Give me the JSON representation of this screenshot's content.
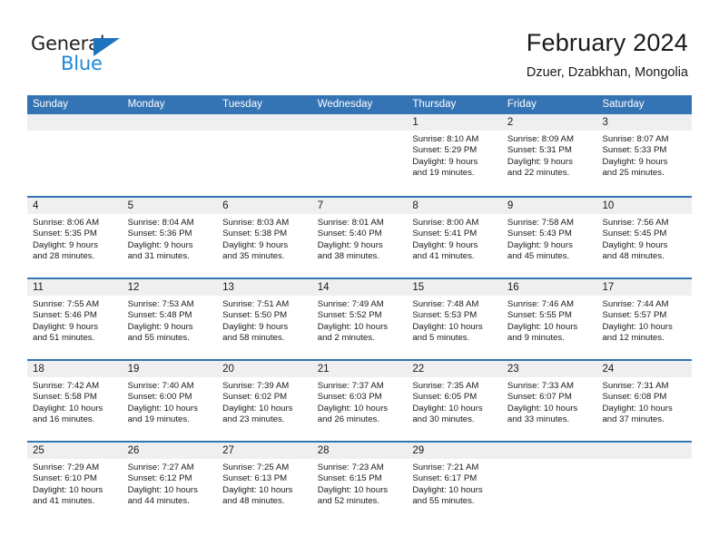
{
  "brand": {
    "logo_line1": "General",
    "logo_line2": "Blue",
    "accent_blue": "#1e73be",
    "logo_blue": "#1e88d8"
  },
  "header": {
    "title": "February 2024",
    "subtitle": "Dzuer, Dzabkhan, Mongolia",
    "header_bg": "#3574b4",
    "day_band_bg": "#efefef"
  },
  "weekdays": [
    "Sunday",
    "Monday",
    "Tuesday",
    "Wednesday",
    "Thursday",
    "Friday",
    "Saturday"
  ],
  "weeks": [
    [
      {
        "day": "",
        "sunrise": "",
        "sunset": "",
        "daylight1": "",
        "daylight2": ""
      },
      {
        "day": "",
        "sunrise": "",
        "sunset": "",
        "daylight1": "",
        "daylight2": ""
      },
      {
        "day": "",
        "sunrise": "",
        "sunset": "",
        "daylight1": "",
        "daylight2": ""
      },
      {
        "day": "",
        "sunrise": "",
        "sunset": "",
        "daylight1": "",
        "daylight2": ""
      },
      {
        "day": "1",
        "sunrise": "Sunrise: 8:10 AM",
        "sunset": "Sunset: 5:29 PM",
        "daylight1": "Daylight: 9 hours",
        "daylight2": "and 19 minutes."
      },
      {
        "day": "2",
        "sunrise": "Sunrise: 8:09 AM",
        "sunset": "Sunset: 5:31 PM",
        "daylight1": "Daylight: 9 hours",
        "daylight2": "and 22 minutes."
      },
      {
        "day": "3",
        "sunrise": "Sunrise: 8:07 AM",
        "sunset": "Sunset: 5:33 PM",
        "daylight1": "Daylight: 9 hours",
        "daylight2": "and 25 minutes."
      }
    ],
    [
      {
        "day": "4",
        "sunrise": "Sunrise: 8:06 AM",
        "sunset": "Sunset: 5:35 PM",
        "daylight1": "Daylight: 9 hours",
        "daylight2": "and 28 minutes."
      },
      {
        "day": "5",
        "sunrise": "Sunrise: 8:04 AM",
        "sunset": "Sunset: 5:36 PM",
        "daylight1": "Daylight: 9 hours",
        "daylight2": "and 31 minutes."
      },
      {
        "day": "6",
        "sunrise": "Sunrise: 8:03 AM",
        "sunset": "Sunset: 5:38 PM",
        "daylight1": "Daylight: 9 hours",
        "daylight2": "and 35 minutes."
      },
      {
        "day": "7",
        "sunrise": "Sunrise: 8:01 AM",
        "sunset": "Sunset: 5:40 PM",
        "daylight1": "Daylight: 9 hours",
        "daylight2": "and 38 minutes."
      },
      {
        "day": "8",
        "sunrise": "Sunrise: 8:00 AM",
        "sunset": "Sunset: 5:41 PM",
        "daylight1": "Daylight: 9 hours",
        "daylight2": "and 41 minutes."
      },
      {
        "day": "9",
        "sunrise": "Sunrise: 7:58 AM",
        "sunset": "Sunset: 5:43 PM",
        "daylight1": "Daylight: 9 hours",
        "daylight2": "and 45 minutes."
      },
      {
        "day": "10",
        "sunrise": "Sunrise: 7:56 AM",
        "sunset": "Sunset: 5:45 PM",
        "daylight1": "Daylight: 9 hours",
        "daylight2": "and 48 minutes."
      }
    ],
    [
      {
        "day": "11",
        "sunrise": "Sunrise: 7:55 AM",
        "sunset": "Sunset: 5:46 PM",
        "daylight1": "Daylight: 9 hours",
        "daylight2": "and 51 minutes."
      },
      {
        "day": "12",
        "sunrise": "Sunrise: 7:53 AM",
        "sunset": "Sunset: 5:48 PM",
        "daylight1": "Daylight: 9 hours",
        "daylight2": "and 55 minutes."
      },
      {
        "day": "13",
        "sunrise": "Sunrise: 7:51 AM",
        "sunset": "Sunset: 5:50 PM",
        "daylight1": "Daylight: 9 hours",
        "daylight2": "and 58 minutes."
      },
      {
        "day": "14",
        "sunrise": "Sunrise: 7:49 AM",
        "sunset": "Sunset: 5:52 PM",
        "daylight1": "Daylight: 10 hours",
        "daylight2": "and 2 minutes."
      },
      {
        "day": "15",
        "sunrise": "Sunrise: 7:48 AM",
        "sunset": "Sunset: 5:53 PM",
        "daylight1": "Daylight: 10 hours",
        "daylight2": "and 5 minutes."
      },
      {
        "day": "16",
        "sunrise": "Sunrise: 7:46 AM",
        "sunset": "Sunset: 5:55 PM",
        "daylight1": "Daylight: 10 hours",
        "daylight2": "and 9 minutes."
      },
      {
        "day": "17",
        "sunrise": "Sunrise: 7:44 AM",
        "sunset": "Sunset: 5:57 PM",
        "daylight1": "Daylight: 10 hours",
        "daylight2": "and 12 minutes."
      }
    ],
    [
      {
        "day": "18",
        "sunrise": "Sunrise: 7:42 AM",
        "sunset": "Sunset: 5:58 PM",
        "daylight1": "Daylight: 10 hours",
        "daylight2": "and 16 minutes."
      },
      {
        "day": "19",
        "sunrise": "Sunrise: 7:40 AM",
        "sunset": "Sunset: 6:00 PM",
        "daylight1": "Daylight: 10 hours",
        "daylight2": "and 19 minutes."
      },
      {
        "day": "20",
        "sunrise": "Sunrise: 7:39 AM",
        "sunset": "Sunset: 6:02 PM",
        "daylight1": "Daylight: 10 hours",
        "daylight2": "and 23 minutes."
      },
      {
        "day": "21",
        "sunrise": "Sunrise: 7:37 AM",
        "sunset": "Sunset: 6:03 PM",
        "daylight1": "Daylight: 10 hours",
        "daylight2": "and 26 minutes."
      },
      {
        "day": "22",
        "sunrise": "Sunrise: 7:35 AM",
        "sunset": "Sunset: 6:05 PM",
        "daylight1": "Daylight: 10 hours",
        "daylight2": "and 30 minutes."
      },
      {
        "day": "23",
        "sunrise": "Sunrise: 7:33 AM",
        "sunset": "Sunset: 6:07 PM",
        "daylight1": "Daylight: 10 hours",
        "daylight2": "and 33 minutes."
      },
      {
        "day": "24",
        "sunrise": "Sunrise: 7:31 AM",
        "sunset": "Sunset: 6:08 PM",
        "daylight1": "Daylight: 10 hours",
        "daylight2": "and 37 minutes."
      }
    ],
    [
      {
        "day": "25",
        "sunrise": "Sunrise: 7:29 AM",
        "sunset": "Sunset: 6:10 PM",
        "daylight1": "Daylight: 10 hours",
        "daylight2": "and 41 minutes."
      },
      {
        "day": "26",
        "sunrise": "Sunrise: 7:27 AM",
        "sunset": "Sunset: 6:12 PM",
        "daylight1": "Daylight: 10 hours",
        "daylight2": "and 44 minutes."
      },
      {
        "day": "27",
        "sunrise": "Sunrise: 7:25 AM",
        "sunset": "Sunset: 6:13 PM",
        "daylight1": "Daylight: 10 hours",
        "daylight2": "and 48 minutes."
      },
      {
        "day": "28",
        "sunrise": "Sunrise: 7:23 AM",
        "sunset": "Sunset: 6:15 PM",
        "daylight1": "Daylight: 10 hours",
        "daylight2": "and 52 minutes."
      },
      {
        "day": "29",
        "sunrise": "Sunrise: 7:21 AM",
        "sunset": "Sunset: 6:17 PM",
        "daylight1": "Daylight: 10 hours",
        "daylight2": "and 55 minutes."
      },
      {
        "day": "",
        "sunrise": "",
        "sunset": "",
        "daylight1": "",
        "daylight2": ""
      },
      {
        "day": "",
        "sunrise": "",
        "sunset": "",
        "daylight1": "",
        "daylight2": ""
      }
    ]
  ]
}
